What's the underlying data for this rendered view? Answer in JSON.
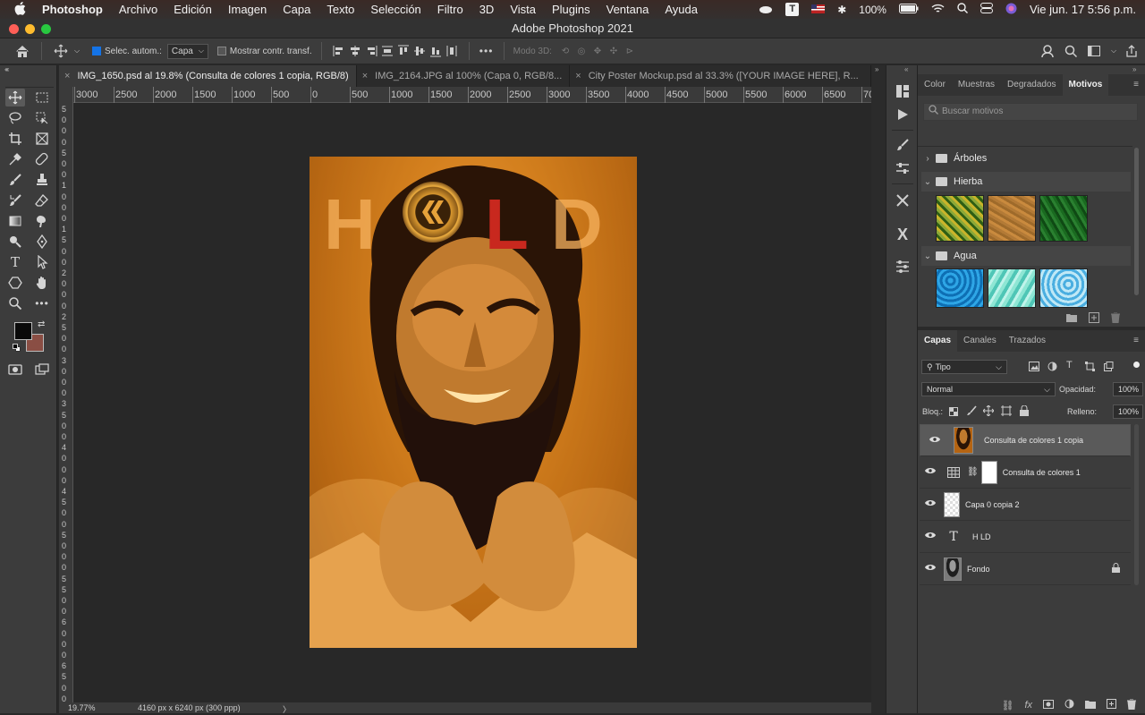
{
  "menubar": {
    "apple": "",
    "app": "Photoshop",
    "items": [
      "Archivo",
      "Edición",
      "Imagen",
      "Capa",
      "Texto",
      "Selección",
      "Filtro",
      "3D",
      "Vista",
      "Plugins",
      "Ventana",
      "Ayuda"
    ],
    "battery": "100%",
    "datetime": "Vie jun. 17  5:56 p.m."
  },
  "window": {
    "title": "Adobe Photoshop 2021"
  },
  "options": {
    "auto_select_label": "Selec. autom.:",
    "auto_select_value": "Capa",
    "show_transform_label": "Mostrar contr. transf.",
    "mode3d_label": "Modo 3D:",
    "more": "•••"
  },
  "tabs": [
    {
      "label": "IMG_1650.psd al 19.8% (Consulta de colores 1 copia, RGB/8)",
      "active": true
    },
    {
      "label": "IMG_2164.JPG al 100% (Capa 0, RGB/8...",
      "active": false
    },
    {
      "label": "City Poster Mockup.psd al 33.3% ([YOUR IMAGE HERE], R...",
      "active": false
    }
  ],
  "ruler": {
    "h_ticks": [
      "3000",
      "2500",
      "2000",
      "1500",
      "1000",
      "500",
      "0",
      "500",
      "1000",
      "1500",
      "2000",
      "2500",
      "3000",
      "3500",
      "4000",
      "4500",
      "5000",
      "5500",
      "6000",
      "6500",
      "70"
    ],
    "v_ticks": [
      "5",
      "0",
      "0",
      "0",
      "5",
      "0",
      "0",
      "1",
      "0",
      "0",
      "0",
      "1",
      "5",
      "0",
      "0",
      "2",
      "0",
      "0",
      "0",
      "2",
      "5",
      "0",
      "0",
      "3",
      "0",
      "0",
      "0",
      "3",
      "5",
      "0",
      "0",
      "4",
      "0",
      "0",
      "0",
      "4",
      "5",
      "0",
      "0",
      "5",
      "0",
      "0",
      "0",
      "5",
      "5",
      "0",
      "0",
      "6",
      "0",
      "0",
      "0",
      "6",
      "5",
      "0",
      "0"
    ]
  },
  "canvas": {
    "text_letters": [
      "H",
      "L",
      "D"
    ],
    "colors": {
      "orange": "#e08a1e",
      "red": "#c8281e"
    }
  },
  "status": {
    "zoom": "19.77%",
    "doc_size": "4160 px x 6240 px (300 ppp)",
    "arrow": "〉"
  },
  "patterns_panel": {
    "tabs": [
      "Color",
      "Muestras",
      "Degradados",
      "Motivos"
    ],
    "active_tab": "Motivos",
    "search_placeholder": "Buscar motivos",
    "groups": [
      {
        "name": "Árboles",
        "expanded": false
      },
      {
        "name": "Hierba",
        "expanded": true,
        "swatches": [
          "#6b8a1e",
          "#b07d3a",
          "#1e6a22"
        ]
      },
      {
        "name": "Agua",
        "expanded": true,
        "swatches": [
          "#1f8fd0",
          "#6fd6c4",
          "#4fb6e0"
        ]
      }
    ]
  },
  "layers_panel": {
    "tabs": [
      "Capas",
      "Canales",
      "Trazados"
    ],
    "active_tab": "Capas",
    "filter": "Tipo",
    "blend_mode": "Normal",
    "opacity_label": "Opacidad:",
    "opacity": "100%",
    "lock_label": "Bloq.:",
    "fill_label": "Relleno:",
    "fill": "100%",
    "layers": [
      {
        "name": "Consulta de colores 1 copia",
        "selected": true,
        "kind": "photo"
      },
      {
        "name": "Consulta de colores 1",
        "selected": false,
        "kind": "adjust"
      },
      {
        "name": "Capa 0 copia 2",
        "selected": false,
        "kind": "empty"
      },
      {
        "name": "H LD",
        "selected": false,
        "kind": "text"
      },
      {
        "name": "Fondo",
        "selected": false,
        "kind": "bw",
        "locked": true
      }
    ]
  }
}
